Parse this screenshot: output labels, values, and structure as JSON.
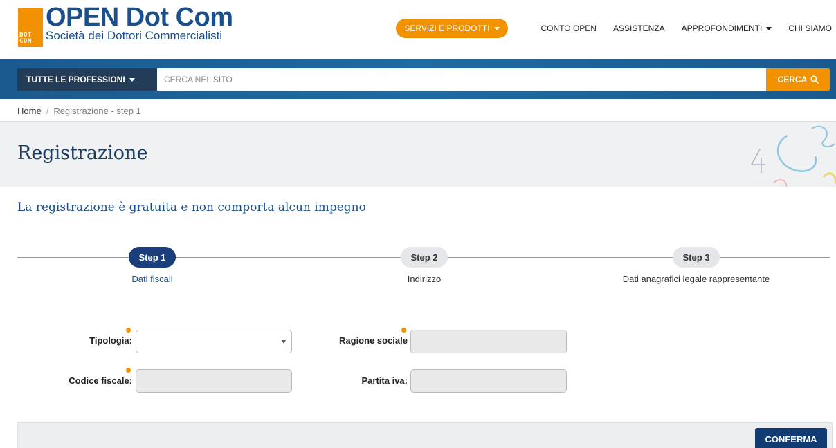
{
  "header": {
    "logo_title": "OPEN Dot Com",
    "logo_subtitle": "Società dei Dottori Commercialisti",
    "logo_mark_line1": "DOT",
    "logo_mark_line2": "COM",
    "nav": {
      "primary": "SERVIZI E PRODOTTI",
      "items": [
        "CONTO OPEN",
        "ASSISTENZA",
        "APPROFONDIMENTI",
        "CHI SIAMO"
      ]
    }
  },
  "search": {
    "category_label": "TUTTE LE PROFESSIONI",
    "placeholder": "CERCA NEL SITO",
    "button_label": "CERCA"
  },
  "breadcrumb": {
    "home": "Home",
    "separator": "/",
    "current": "Registrazione - step 1"
  },
  "page": {
    "title": "Registrazione",
    "intro": "La registrazione è gratuita e non comporta alcun impegno"
  },
  "steps": [
    {
      "label": "Step 1",
      "caption": "Dati fiscali",
      "active": true
    },
    {
      "label": "Step 2",
      "caption": "Indirizzo",
      "active": false
    },
    {
      "label": "Step 3",
      "caption": "Dati anagrafici legale rappresentante",
      "active": false
    }
  ],
  "form": {
    "tipologia_label": "Tipologia:",
    "tipologia_value": "",
    "ragione_sociale_label": "Ragione sociale",
    "ragione_sociale_value": "",
    "codice_fiscale_label": "Codice fiscale:",
    "codice_fiscale_value": "",
    "partita_iva_label": "Partita iva:",
    "partita_iva_value": ""
  },
  "actions": {
    "confirm_label": "CONFERMA"
  },
  "colors": {
    "accent_orange": "#f39200",
    "brand_blue": "#1a4f8b",
    "dark_navy": "#123a73"
  }
}
